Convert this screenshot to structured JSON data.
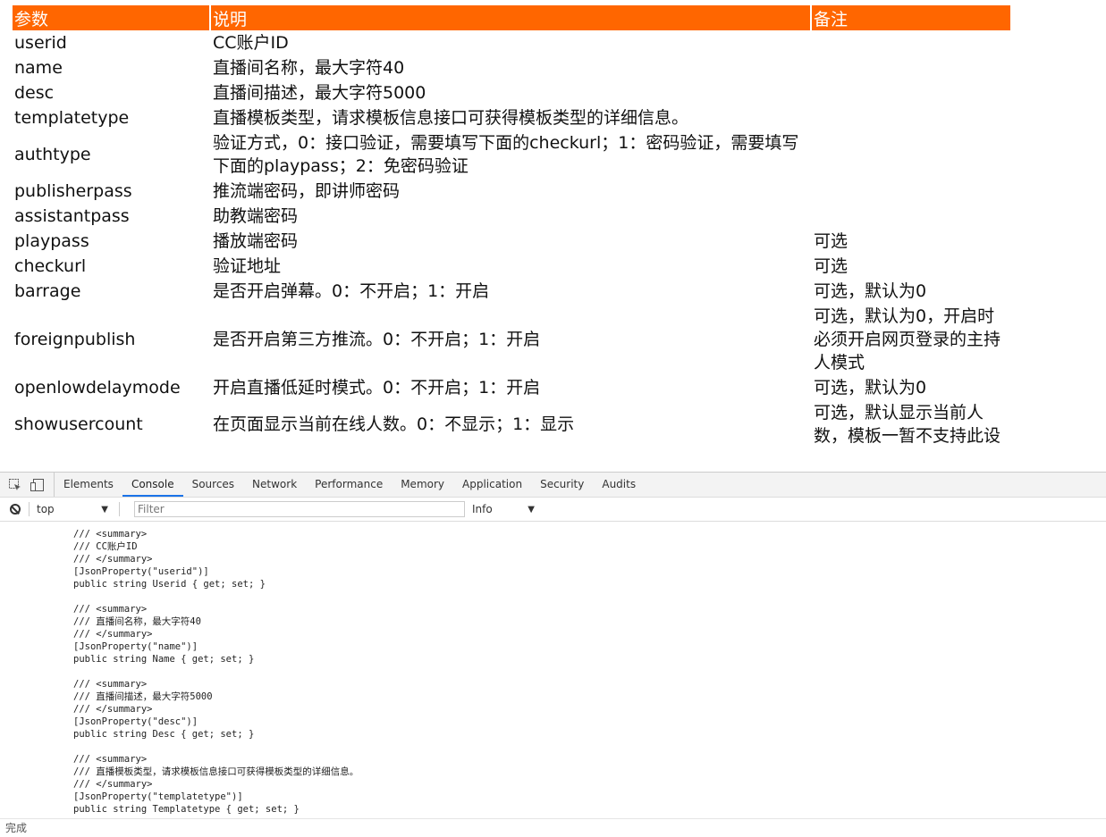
{
  "table": {
    "headers": [
      "参数",
      "说明",
      "备注"
    ],
    "rows": [
      {
        "param": "userid",
        "desc": "CC账户ID",
        "note": ""
      },
      {
        "param": "name",
        "desc": "直播间名称，最大字符40",
        "note": ""
      },
      {
        "param": "desc",
        "desc": "直播间描述，最大字符5000",
        "note": ""
      },
      {
        "param": "templatetype",
        "desc": "直播模板类型，请求模板信息接口可获得模板类型的详细信息。",
        "note": ""
      },
      {
        "param": "authtype",
        "desc": "验证方式，0：接口验证，需要填写下面的checkurl；1：密码验证，需要填写下面的playpass；2：免密码验证",
        "note": ""
      },
      {
        "param": "publisherpass",
        "desc": "推流端密码，即讲师密码",
        "note": ""
      },
      {
        "param": "assistantpass",
        "desc": "助教端密码",
        "note": ""
      },
      {
        "param": "playpass",
        "desc": "播放端密码",
        "note": "可选"
      },
      {
        "param": "checkurl",
        "desc": "验证地址",
        "note": "可选"
      },
      {
        "param": "barrage",
        "desc": "是否开启弹幕。0：不开启；1：开启",
        "note": "可选，默认为0"
      },
      {
        "param": "foreignpublish",
        "desc": "是否开启第三方推流。0：不开启；1：开启",
        "note": "可选，默认为0，开启时必须开启网页登录的主持人模式"
      },
      {
        "param": "openlowdelaymode",
        "desc": "开启直播低延时模式。0：不开启；1：开启",
        "note": "可选，默认为0"
      },
      {
        "param": "showusercount",
        "desc": "在页面显示当前在线人数。0：不显示；1：显示",
        "note": "可选，默认显示当前人数，模板一暂不支持此设"
      }
    ]
  },
  "devtools": {
    "tabs": [
      "Elements",
      "Console",
      "Sources",
      "Network",
      "Performance",
      "Memory",
      "Application",
      "Security",
      "Audits"
    ],
    "active_tab": "Console",
    "context": "top",
    "filter_placeholder": "Filter",
    "level": "Info",
    "console_output": "/// <summary>\n/// CC账户ID\n/// </summary>\n[JsonProperty(\"userid\")]\npublic string Userid { get; set; }\n\n/// <summary>\n/// 直播间名称，最大字符40\n/// </summary>\n[JsonProperty(\"name\")]\npublic string Name { get; set; }\n\n/// <summary>\n/// 直播间描述，最大字符5000\n/// </summary>\n[JsonProperty(\"desc\")]\npublic string Desc { get; set; }\n\n/// <summary>\n/// 直播模板类型，请求模板信息接口可获得模板类型的详细信息。\n/// </summary>\n[JsonProperty(\"templatetype\")]\npublic string Templatetype { get; set; }"
  },
  "statusbar": {
    "text": "完成"
  },
  "colors": {
    "header_bg": "#ff6600",
    "active_tab_underline": "#1a73e8"
  }
}
